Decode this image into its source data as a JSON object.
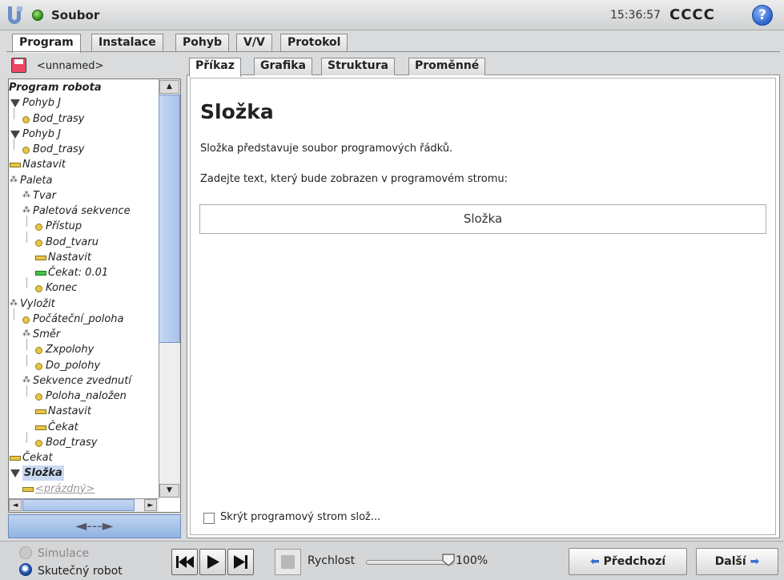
{
  "header": {
    "file_label": "Soubor",
    "time": "15:36:57",
    "robot_name": "CCCC",
    "help_glyph": "?",
    "status_color": "#3aa51b"
  },
  "main_tabs": [
    {
      "label": "Program",
      "active": true
    },
    {
      "label": "Instalace",
      "active": false
    },
    {
      "label": "Pohyb",
      "active": false
    },
    {
      "label": "V/V",
      "active": false
    },
    {
      "label": "Protokol",
      "active": false
    }
  ],
  "program": {
    "name": "<unnamed>",
    "tree": [
      {
        "label": "Program robota",
        "icon": "none",
        "level": 0
      },
      {
        "label": "Pohyb J",
        "icon": "expand-triangle",
        "level": 0
      },
      {
        "label": "Bod_trasy",
        "icon": "waypoint-bullet",
        "level": 1
      },
      {
        "label": "Pohyb J",
        "icon": "expand-triangle",
        "level": 0
      },
      {
        "label": "Bod_trasy",
        "icon": "waypoint-bullet",
        "level": 1
      },
      {
        "label": "Nastavit",
        "icon": "set-bar",
        "level": 0
      },
      {
        "label": "Paleta",
        "icon": "pallet-dots",
        "level": 0
      },
      {
        "label": "Tvar",
        "icon": "pallet-dots",
        "level": 1
      },
      {
        "label": "Paletová sekvence",
        "icon": "pallet-dots",
        "level": 1
      },
      {
        "label": "Přístup",
        "icon": "waypoint-bullet",
        "level": 2
      },
      {
        "label": "Bod_tvaru",
        "icon": "waypoint-bullet",
        "level": 2
      },
      {
        "label": "Nastavit",
        "icon": "set-bar",
        "level": 2
      },
      {
        "label": "Čekat: 0.01",
        "icon": "wait-bar",
        "level": 2
      },
      {
        "label": "Konec",
        "icon": "waypoint-bullet",
        "level": 2
      },
      {
        "label": "Vyložit",
        "icon": "pallet-dots",
        "level": 0
      },
      {
        "label": "Počáteční_poloha",
        "icon": "waypoint-bullet",
        "level": 1
      },
      {
        "label": "Směr",
        "icon": "pallet-dots",
        "level": 1
      },
      {
        "label": "Zxpolohy",
        "icon": "waypoint-bullet",
        "level": 2
      },
      {
        "label": "Do_polohy",
        "icon": "waypoint-bullet",
        "level": 2
      },
      {
        "label": "Sekvence zvednutí",
        "icon": "pallet-dots",
        "level": 1
      },
      {
        "label": "Poloha_naložen",
        "icon": "waypoint-bullet",
        "level": 2
      },
      {
        "label": "Nastavit",
        "icon": "set-bar",
        "level": 2
      },
      {
        "label": "Čekat",
        "icon": "set-bar",
        "level": 2
      },
      {
        "label": "Bod_trasy",
        "icon": "waypoint-bullet",
        "level": 2
      },
      {
        "label": "Čekat",
        "icon": "set-bar",
        "level": 0
      },
      {
        "label": "Složka",
        "icon": "expand-triangle",
        "level": 0,
        "selected": true
      },
      {
        "label": "<prázdný>",
        "icon": "set-bar",
        "level": 1
      }
    ],
    "collapse_glyph": "◄---►"
  },
  "sub_tabs": [
    {
      "label": "Příkaz",
      "active": true
    },
    {
      "label": "Grafika",
      "active": false
    },
    {
      "label": "Struktura",
      "active": false
    },
    {
      "label": "Proměnné",
      "active": false
    }
  ],
  "content": {
    "title": "Složka",
    "description": "Složka představuje soubor programových řádků.",
    "prompt": "Zadejte text, který bude zobrazen v programovém stromu:",
    "input_value": "Složka",
    "hide_checkbox_label": "Skrýt programový strom slož...",
    "hide_checked": false
  },
  "footer": {
    "simulation_label": "Simulace",
    "real_robot_label": "Skutečný robot",
    "speed_label": "Rychlost",
    "speed_value": "100%",
    "speed_fraction": 1.0,
    "prev_label": "Předchozí",
    "next_label": "Další"
  }
}
